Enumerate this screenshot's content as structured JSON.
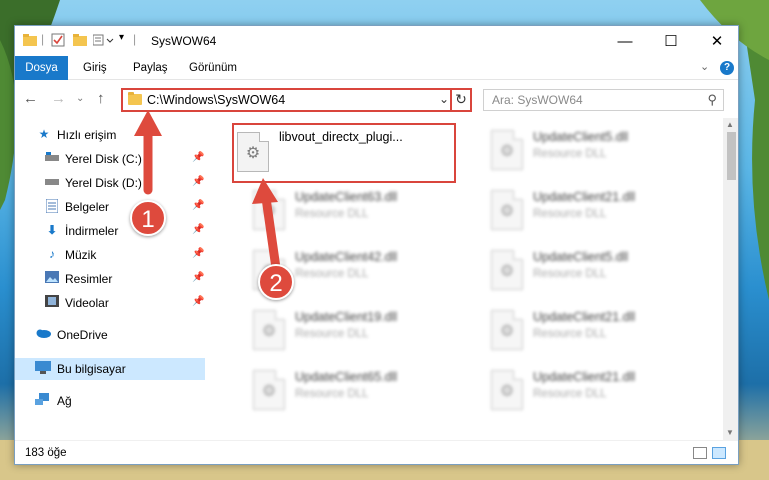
{
  "window": {
    "title": "SysWOW64"
  },
  "ribbon": {
    "tabs": [
      "Dosya",
      "Giriş",
      "Paylaş",
      "Görünüm"
    ]
  },
  "navigation": {
    "address": "C:\\Windows\\SysWOW64",
    "search_placeholder": "Ara: SysWOW64"
  },
  "sidebar": {
    "items": [
      {
        "label": "Hızlı erişim",
        "icon": "star-icon"
      },
      {
        "label": "Yerel Disk (C:)",
        "icon": "drive-icon"
      },
      {
        "label": "Yerel Disk (D:)",
        "icon": "drive-icon"
      },
      {
        "label": "Belgeler",
        "icon": "documents-icon"
      },
      {
        "label": "İndirmeler",
        "icon": "download-icon"
      },
      {
        "label": "Müzik",
        "icon": "music-icon"
      },
      {
        "label": "Resimler",
        "icon": "pictures-icon"
      },
      {
        "label": "Videolar",
        "icon": "video-icon"
      },
      {
        "label": "OneDrive",
        "icon": "cloud-icon"
      },
      {
        "label": "Bu bilgisayar",
        "icon": "computer-icon"
      },
      {
        "label": "Ağ",
        "icon": "network-icon"
      }
    ]
  },
  "files": {
    "highlighted": {
      "name": "libvout_directx_plugi..."
    },
    "items": [
      {
        "name": "UpdateClient5.dll",
        "type": "Resource DLL"
      },
      {
        "name": "UpdateClient63.dll",
        "type": "Resource DLL"
      },
      {
        "name": "UpdateClient21.dll",
        "type": "Resource DLL"
      },
      {
        "name": "UpdateClient42.dll",
        "type": "Resource DLL"
      },
      {
        "name": "UpdateClient5.dll",
        "type": "Resource DLL"
      },
      {
        "name": "UpdateClient19.dll",
        "type": "Resource DLL"
      },
      {
        "name": "UpdateClient21.dll",
        "type": "Resource DLL"
      },
      {
        "name": "UpdateClient65.dll",
        "type": "Resource DLL"
      },
      {
        "name": "UpdateClient21.dll",
        "type": "Resource DLL"
      }
    ]
  },
  "status": {
    "count": "183 öğe"
  },
  "callouts": [
    "1",
    "2"
  ],
  "colors": {
    "accent": "#1979ca",
    "highlight": "#d9453c",
    "selected": "#cce8ff"
  }
}
